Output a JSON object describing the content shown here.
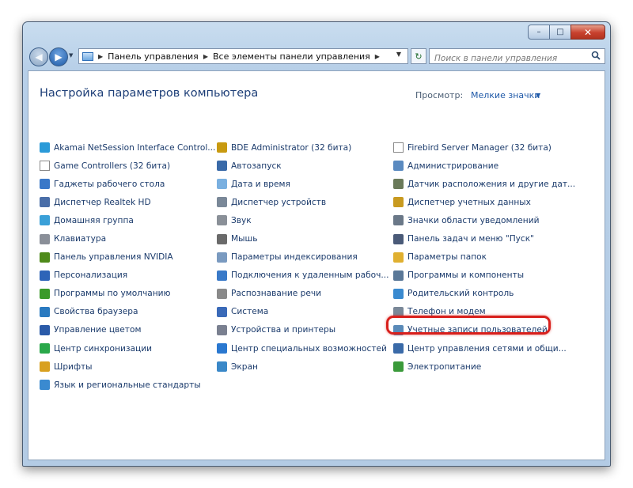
{
  "window": {
    "caption_buttons": {
      "minimize": "–",
      "maximize": "□",
      "close": "✕"
    }
  },
  "nav": {
    "back_icon": "back-arrow-icon",
    "forward_icon": "forward-arrow-icon",
    "breadcrumb": [
      "Панель управления",
      "Все элементы панели управления"
    ],
    "search_placeholder": "Поиск в панели управления"
  },
  "header": {
    "title": "Настройка параметров компьютера",
    "view_label": "Просмотр:",
    "view_value": "Мелкие значки"
  },
  "columns": [
    [
      {
        "label": "Akamai NetSession Interface Control...",
        "icon": "akamai-icon",
        "color": "#2a9ad8"
      },
      {
        "label": "Game Controllers (32 бита)",
        "icon": "document-icon",
        "color": "#ffffff"
      },
      {
        "label": "Гаджеты рабочего стола",
        "icon": "gadgets-icon",
        "color": "#3a78c8"
      },
      {
        "label": "Диспетчер Realtek HD",
        "icon": "realtek-icon",
        "color": "#4a6ea8"
      },
      {
        "label": "Домашняя группа",
        "icon": "homegroup-icon",
        "color": "#3aa0d8"
      },
      {
        "label": "Клавиатура",
        "icon": "keyboard-icon",
        "color": "#8a8f98"
      },
      {
        "label": "Панель управления NVIDIA",
        "icon": "nvidia-icon",
        "color": "#4e8a1a"
      },
      {
        "label": "Персонализация",
        "icon": "personalization-icon",
        "color": "#2e64b8"
      },
      {
        "label": "Программы по умолчанию",
        "icon": "default-programs-icon",
        "color": "#3a9a2a"
      },
      {
        "label": "Свойства браузера",
        "icon": "internet-options-icon",
        "color": "#2a7ac0"
      },
      {
        "label": "Управление цветом",
        "icon": "color-management-icon",
        "color": "#2a5aa8"
      },
      {
        "label": "Центр синхронизации",
        "icon": "sync-center-icon",
        "color": "#2aa84a"
      },
      {
        "label": "Шрифты",
        "icon": "fonts-icon",
        "color": "#d8a020"
      },
      {
        "label": "Язык и региональные стандарты",
        "icon": "region-icon",
        "color": "#3a8ad0"
      }
    ],
    [
      {
        "label": "BDE Administrator (32 бита)",
        "icon": "bde-icon",
        "color": "#c89a10"
      },
      {
        "label": "Автозапуск",
        "icon": "autoplay-icon",
        "color": "#3a6aa8"
      },
      {
        "label": "Дата и время",
        "icon": "date-time-icon",
        "color": "#7ab0e0"
      },
      {
        "label": "Диспетчер устройств",
        "icon": "device-manager-icon",
        "color": "#7a8898"
      },
      {
        "label": "Звук",
        "icon": "sound-icon",
        "color": "#8a9098"
      },
      {
        "label": "Мышь",
        "icon": "mouse-icon",
        "color": "#6a6a6a"
      },
      {
        "label": "Параметры индексирования",
        "icon": "indexing-icon",
        "color": "#7a9ac0"
      },
      {
        "label": "Подключения к удаленным рабоч...",
        "icon": "remote-desktop-icon",
        "color": "#3a7ac8"
      },
      {
        "label": "Распознавание речи",
        "icon": "speech-icon",
        "color": "#8a8a8a"
      },
      {
        "label": "Система",
        "icon": "system-icon",
        "color": "#3a6ab8"
      },
      {
        "label": "Устройства и принтеры",
        "icon": "printers-icon",
        "color": "#7a8090"
      },
      {
        "label": "Центр специальных возможностей",
        "icon": "ease-of-access-icon",
        "color": "#2a78d0"
      },
      {
        "label": "Экран",
        "icon": "display-icon",
        "color": "#3a88c8"
      }
    ],
    [
      {
        "label": "Firebird Server Manager (32 бита)",
        "icon": "document-icon",
        "color": "#ffffff"
      },
      {
        "label": "Администрирование",
        "icon": "administrative-tools-icon",
        "color": "#5a8ac0"
      },
      {
        "label": "Датчик расположения и другие дат...",
        "icon": "location-sensor-icon",
        "color": "#6a7a5a"
      },
      {
        "label": "Диспетчер учетных данных",
        "icon": "credential-manager-icon",
        "color": "#c89a20"
      },
      {
        "label": "Значки области уведомлений",
        "icon": "notification-icons-icon",
        "color": "#6a7888"
      },
      {
        "label": "Панель задач и меню \"Пуск\"",
        "icon": "taskbar-icon",
        "color": "#4a5a78"
      },
      {
        "label": "Параметры папок",
        "icon": "folder-options-icon",
        "color": "#e0b030"
      },
      {
        "label": "Программы и компоненты",
        "icon": "programs-features-icon",
        "color": "#5a7898"
      },
      {
        "label": "Родительский контроль",
        "icon": "parental-controls-icon",
        "color": "#3a8ad0"
      },
      {
        "label": "Телефон и модем",
        "icon": "phone-modem-icon",
        "color": "#7a8898"
      },
      {
        "label": "Учетные записи пользователей",
        "icon": "user-accounts-icon",
        "color": "#5a8ab8"
      },
      {
        "label": "Центр управления сетями и общи...",
        "icon": "network-center-icon",
        "color": "#3a6aa8"
      },
      {
        "label": "Электропитание",
        "icon": "power-options-icon",
        "color": "#3a9a3a"
      }
    ]
  ],
  "highlighted_item": "Учетные записи пользователей",
  "colors": {
    "link": "#1a3a6b",
    "title": "#1e3f78",
    "highlight": "#d8201c"
  }
}
